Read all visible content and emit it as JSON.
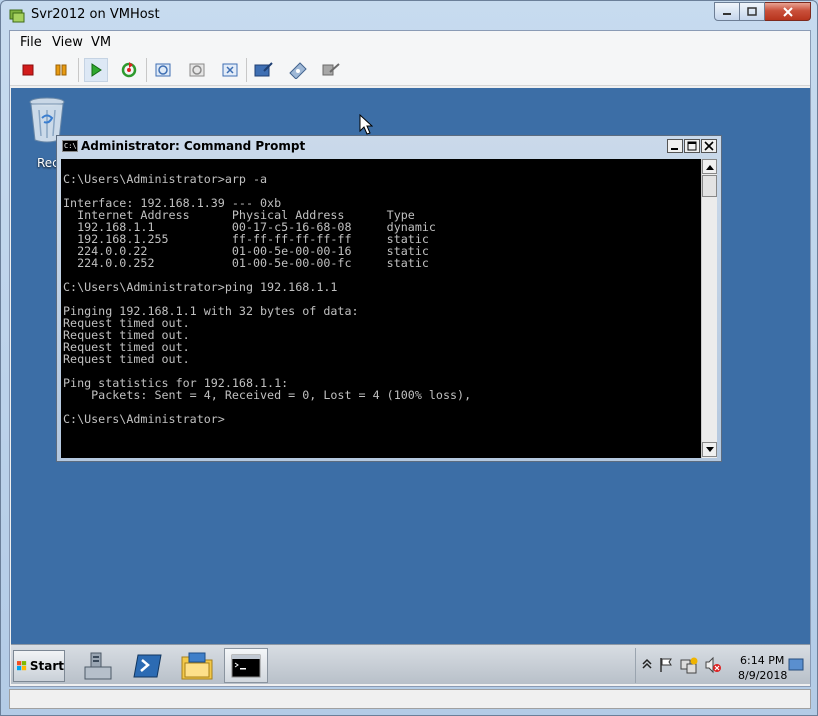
{
  "host_window": {
    "title": "Svr2012 on VMHost",
    "icon": "vm-connection-icon"
  },
  "menu": {
    "items": [
      "File",
      "View",
      "VM"
    ]
  },
  "toolbar": {
    "buttons": [
      "turn-off-icon",
      "pause-icon",
      "start-icon",
      "reset-icon",
      "checkpoint-icon",
      "revert-icon",
      "enhanced-session-icon",
      "ctrl-alt-del-icon",
      "insert-disk-icon",
      "settings-icon"
    ]
  },
  "desktop": {
    "recycle_bin_label": "Recycle Bin"
  },
  "cmd": {
    "title": "Administrator: Command Prompt",
    "console_text": "C:\\Users\\Administrator>arp -a\n\nInterface: 192.168.1.39 --- 0xb\n  Internet Address      Physical Address      Type\n  192.168.1.1           00-17-c5-16-68-08     dynamic\n  192.168.1.255         ff-ff-ff-ff-ff-ff     static\n  224.0.0.22            01-00-5e-00-00-16     static\n  224.0.0.252           01-00-5e-00-00-fc     static\n\nC:\\Users\\Administrator>ping 192.168.1.1\n\nPinging 192.168.1.1 with 32 bytes of data:\nRequest timed out.\nRequest timed out.\nRequest timed out.\nRequest timed out.\n\nPing statistics for 192.168.1.1:\n    Packets: Sent = 4, Received = 0, Lost = 4 (100% loss),\n\nC:\\Users\\Administrator>"
  },
  "taskbar": {
    "start_label": "Start",
    "pinned": [
      "server-manager-icon",
      "powershell-icon",
      "file-explorer-icon",
      "command-prompt-icon"
    ],
    "clock_time": "6:14 PM",
    "clock_date": "8/9/2018"
  },
  "colors": {
    "desktop_bg": "#3c6ea6",
    "console_bg": "#000000",
    "console_fg": "#c0c0c0"
  }
}
